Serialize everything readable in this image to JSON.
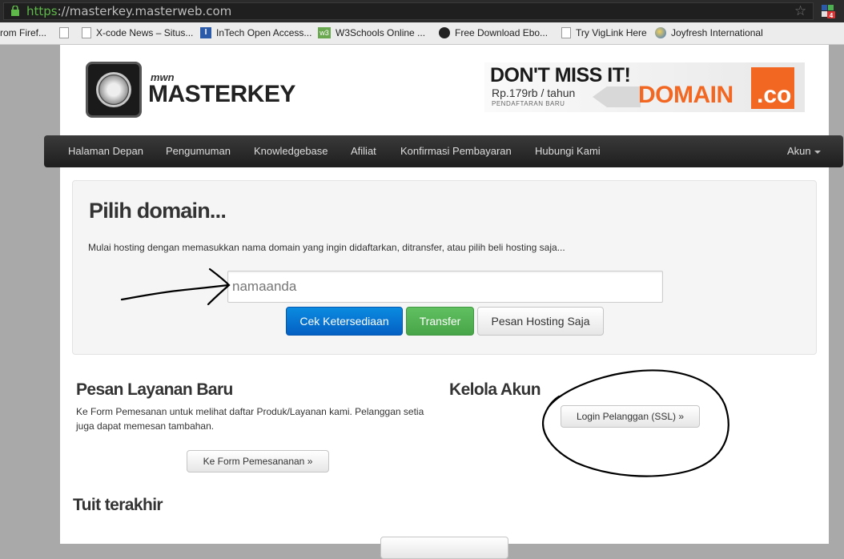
{
  "browser": {
    "url_scheme": "https",
    "url_rest": "://masterkey.masterweb.com",
    "bookmarks": [
      "rom Firef...",
      "",
      "X-code News – Situs...",
      "InTech Open Access...",
      "W3Schools Online ...",
      "Free Download Ebo...",
      "Try VigLink Here",
      "Joyfresh International"
    ],
    "ext_badge": "4"
  },
  "header": {
    "brand_small": "mwn",
    "brand": "MASTERKEY",
    "banner": {
      "headline": "DON'T MISS IT!",
      "price": "Rp.179rb / tahun",
      "note": "PENDAFTARAN BARU",
      "domain": "DOMAIN",
      "tld": ".co"
    }
  },
  "nav": {
    "items": [
      "Halaman Depan",
      "Pengumuman",
      "Knowledgebase",
      "Afiliat",
      "Konfirmasi Pembayaran",
      "Hubungi Kami"
    ],
    "account": "Akun"
  },
  "hero": {
    "title": "Pilih domain...",
    "description": "Mulai hosting dengan memasukkan nama domain yang ingin didaftarkan, ditransfer, atau pilih beli hosting saja...",
    "input_value": "namaanda",
    "btn_check": "Cek Ketersediaan",
    "btn_transfer": "Transfer",
    "btn_hosting": "Pesan Hosting Saja"
  },
  "order": {
    "title": "Pesan Layanan Baru",
    "text": "Ke Form Pemesanan untuk melihat daftar Produk/Layanan kami. Pelanggan setia juga dapat memesan tambahan.",
    "button": "Ke Form Pemesananan »"
  },
  "account": {
    "title": "Kelola Akun",
    "button": "Login Pelanggan (SSL) »"
  },
  "tweets": {
    "title": "Tuit terakhir"
  },
  "colors": {
    "primary": "#0a7ad6",
    "success": "#5bb75b",
    "navbar": "#2a2a2a",
    "banner_orange": "#f26722"
  }
}
